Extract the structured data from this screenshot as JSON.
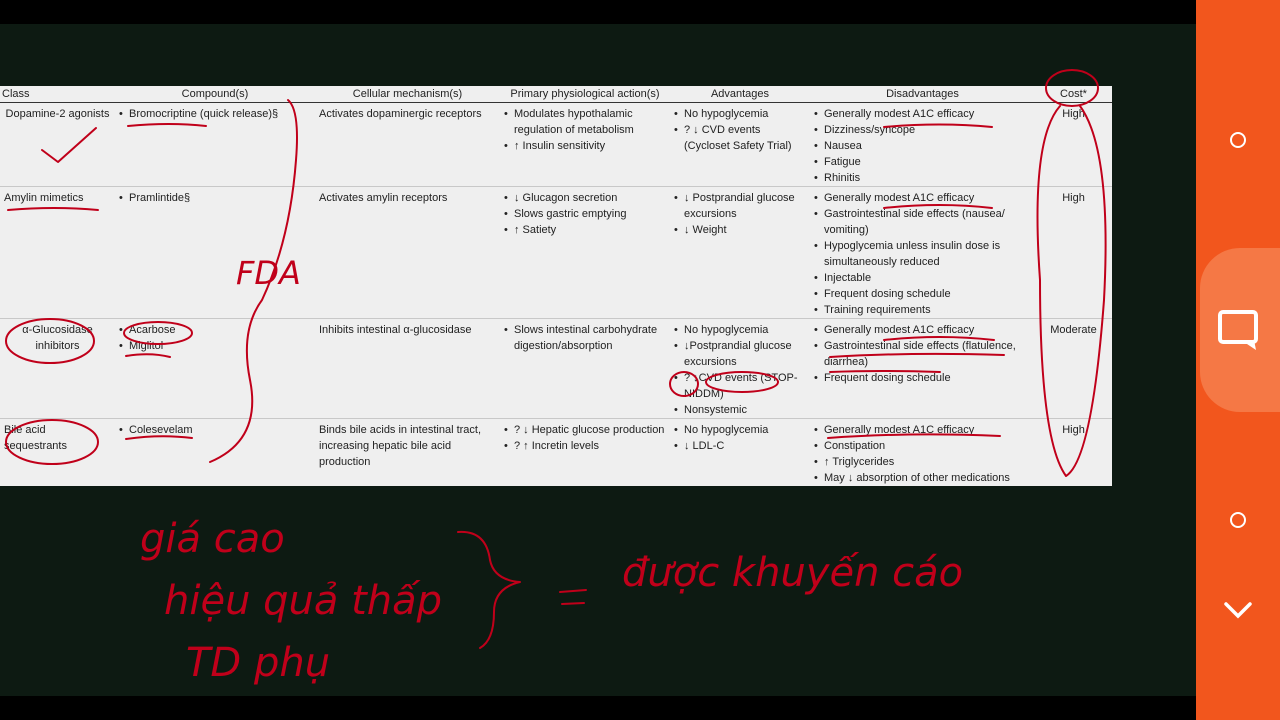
{
  "table": {
    "headers": [
      "Class",
      "Compound(s)",
      "Cellular mechanism(s)",
      "Primary physiological action(s)",
      "Advantages",
      "Disadvantages",
      "Cost*"
    ],
    "rows": [
      {
        "class": "Dopamine-2 agonists",
        "compounds": [
          "Bromocriptine (quick release)§"
        ],
        "mechanism": "Activates dopaminergic receptors",
        "actions": [
          "Modulates hypothalamic regulation of metabolism",
          "↑ Insulin sensitivity"
        ],
        "advantages": [
          "No hypoglycemia",
          "? ↓ CVD events (Cycloset Safety Trial)"
        ],
        "disadvantages": [
          "Generally modest A1C efficacy",
          "Dizziness/syncope",
          "Nausea",
          "Fatigue",
          "Rhinitis"
        ],
        "cost": "High"
      },
      {
        "class": "Amylin mimetics",
        "compounds": [
          "Pramlintide§"
        ],
        "mechanism": "Activates amylin receptors",
        "actions": [
          "↓ Glucagon secretion",
          "Slows gastric emptying",
          "↑ Satiety"
        ],
        "advantages": [
          "↓ Postprandial glucose excursions",
          "↓ Weight"
        ],
        "disadvantages": [
          "Generally modest A1C efficacy",
          "Gastrointestinal side effects (nausea/ vomiting)",
          "Hypoglycemia unless insulin dose is simultaneously reduced",
          "Injectable",
          "Frequent dosing schedule",
          "Training requirements"
        ],
        "cost": "High"
      },
      {
        "class": "α-Glucosidase inhibitors",
        "compounds": [
          "Acarbose",
          "Miglitol"
        ],
        "mechanism": "Inhibits intestinal α-glucosidase",
        "actions": [
          "Slows intestinal carbohydrate digestion/absorption"
        ],
        "advantages": [
          "No hypoglycemia",
          "↓Postprandial glucose excursions",
          "? ↓CVD events (STOP-NIDDM)",
          "Nonsystemic"
        ],
        "disadvantages": [
          "Generally modest A1C efficacy",
          "Gastrointestinal side effects (flatulence, diarrhea)",
          "Frequent dosing schedule"
        ],
        "cost": "Moderate"
      },
      {
        "class": "Bile acid sequestrants",
        "compounds": [
          "Colesevelam"
        ],
        "mechanism": "Binds bile acids in intestinal tract, increasing hepatic bile acid production",
        "actions": [
          "? ↓ Hepatic glucose production",
          "? ↑ Incretin levels"
        ],
        "advantages": [
          "No hypoglycemia",
          "↓ LDL-C"
        ],
        "disadvantages": [
          "Generally modest A1C efficacy",
          "Constipation",
          "↑ Triglycerides",
          "May ↓ absorption of other medications"
        ],
        "cost": "High"
      }
    ]
  },
  "annotations": {
    "fda": "FDA",
    "line1": "giá cao",
    "line2": "hiệu quả thấp",
    "line3": "TD phụ",
    "conclusion": "được khuyến cáo"
  },
  "colors": {
    "ink": "#c0001a",
    "sidebar": "#f2561d",
    "board": "#0d1a12"
  },
  "sidebar_icons": [
    "circle-icon",
    "chat-icon",
    "circle-icon",
    "chevron-down-icon"
  ]
}
